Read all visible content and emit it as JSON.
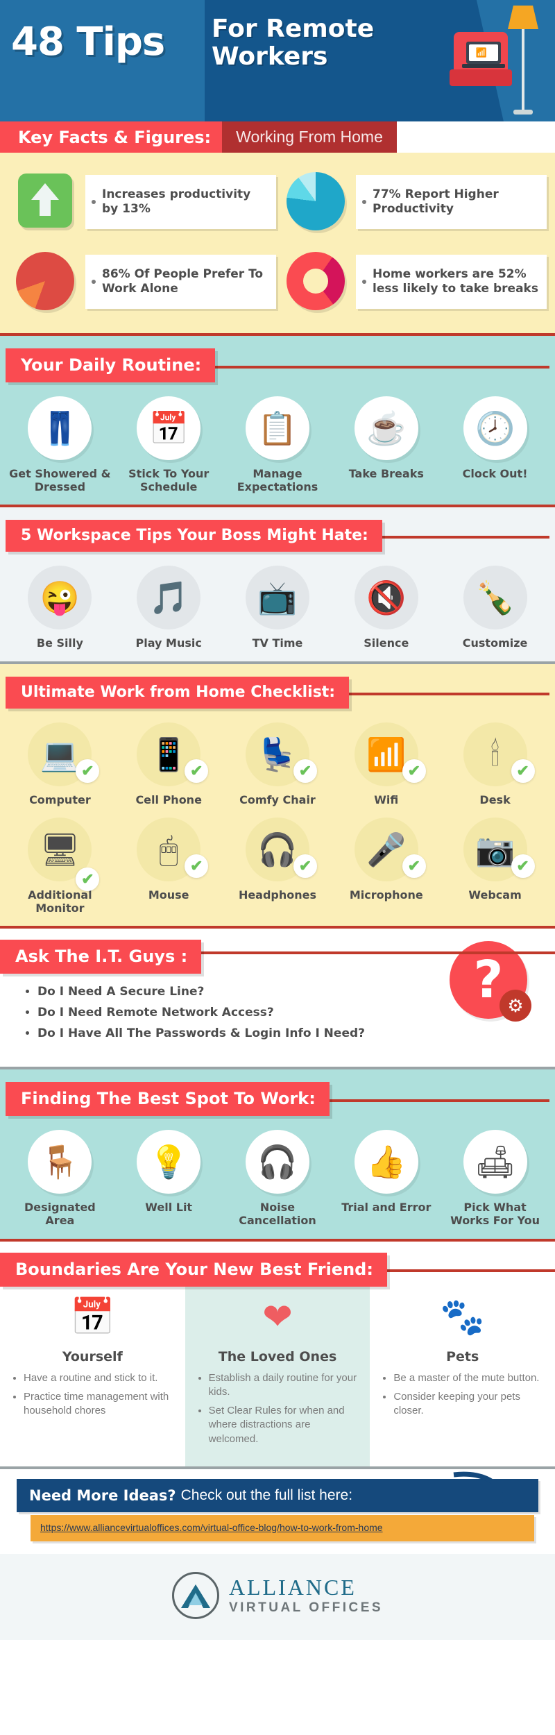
{
  "header": {
    "title_left": "48 Tips",
    "title_right": "For Remote Workers"
  },
  "key_facts": {
    "label": "Key Facts & Figures:",
    "sublabel": "Working From Home",
    "items": [
      {
        "icon": "up-arrow-icon",
        "text": "Increases productivity by 13%"
      },
      {
        "icon": "pie-chart-blue-icon",
        "text": "77% Report Higher Productivity"
      },
      {
        "icon": "pie-chart-red-icon",
        "text": "86% Of People Prefer To Work Alone"
      },
      {
        "icon": "donut-chart-icon",
        "text": "Home workers are 52% less likely to take breaks"
      }
    ]
  },
  "daily_routine": {
    "heading": "Your Daily Routine:",
    "items": [
      {
        "icon": "jeans-icon",
        "glyph": "👖",
        "label": "Get Showered & Dressed"
      },
      {
        "icon": "calendar-icon",
        "glyph": "📅",
        "label": "Stick To Your Schedule"
      },
      {
        "icon": "checklist-icon",
        "glyph": "📋",
        "label": "Manage Expectations"
      },
      {
        "icon": "coffee-dog-icon",
        "glyph": "☕",
        "label": "Take Breaks"
      },
      {
        "icon": "clock-icon",
        "glyph": "🕗",
        "label": "Clock Out!"
      }
    ]
  },
  "workspace_tips": {
    "heading": "5 Workspace Tips Your Boss Might Hate:",
    "items": [
      {
        "icon": "winking-face-icon",
        "glyph": "😜",
        "label": "Be Silly"
      },
      {
        "icon": "music-note-icon",
        "glyph": "🎵",
        "label": "Play Music"
      },
      {
        "icon": "television-icon",
        "glyph": "📺",
        "label": "TV Time"
      },
      {
        "icon": "mute-silence-icon",
        "glyph": "🔇",
        "label": "Silence"
      },
      {
        "icon": "message-bottle-icon",
        "glyph": "🍾",
        "label": "Customize"
      }
    ]
  },
  "checklist": {
    "heading": "Ultimate Work from Home Checklist:",
    "check_glyph": "✔",
    "items": [
      {
        "icon": "laptop-icon",
        "glyph": "💻",
        "label": "Computer"
      },
      {
        "icon": "cellphone-icon",
        "glyph": "📱",
        "label": "Cell Phone"
      },
      {
        "icon": "armchair-icon",
        "glyph": "💺",
        "label": "Comfy Chair"
      },
      {
        "icon": "wifi-icon",
        "glyph": "📶",
        "label": "Wifi"
      },
      {
        "icon": "desk-lamp-icon",
        "glyph": "🕯",
        "label": "Desk"
      },
      {
        "icon": "monitor-icon",
        "glyph": "🖥",
        "label": "Additional Monitor"
      },
      {
        "icon": "mouse-icon",
        "glyph": "🖱",
        "label": "Mouse"
      },
      {
        "icon": "headphones-icon",
        "glyph": "🎧",
        "label": "Headphones"
      },
      {
        "icon": "microphone-icon",
        "glyph": "🎤",
        "label": "Microphone"
      },
      {
        "icon": "webcam-icon",
        "glyph": "📷",
        "label": "Webcam"
      }
    ]
  },
  "it_guys": {
    "heading": "Ask The I.T. Guys :",
    "question_glyph": "?",
    "gear_glyph": "⚙",
    "questions": [
      "Do I Need A Secure Line?",
      "Do I Need Remote Network Access?",
      "Do I Have All The Passwords & Login Info I Need?"
    ]
  },
  "best_spot": {
    "heading": "Finding The Best Spot To Work:",
    "items": [
      {
        "icon": "desk-chair-icon",
        "glyph": "🪑",
        "label": "Designated Area"
      },
      {
        "icon": "lightbulb-icon",
        "glyph": "💡",
        "label": "Well Lit"
      },
      {
        "icon": "headphones-icon",
        "glyph": "🎧",
        "label": "Noise Cancellation"
      },
      {
        "icon": "thumbs-up-icon",
        "glyph": "👍",
        "label": "Trial and Error"
      },
      {
        "icon": "sofa-icon",
        "glyph": "🛋",
        "label": "Pick What Works For You"
      }
    ]
  },
  "boundaries": {
    "heading": "Boundaries Are Your New Best Friend:",
    "columns": [
      {
        "icon": "calendar-icon",
        "glyph": "📅",
        "title": "Yourself",
        "bullets": [
          "Have a routine and stick to it.",
          "Practice time management with household chores"
        ]
      },
      {
        "icon": "heart-icon",
        "glyph": "❤",
        "title": "The Loved Ones",
        "bullets": [
          "Establish a daily routine for your kids.",
          "Set Clear Rules for when and where distractions are welcomed."
        ]
      },
      {
        "icon": "paw-print-icon",
        "glyph": "🐾",
        "title": "Pets",
        "bullets": [
          "Be a master of the mute button.",
          "Consider keeping your pets closer."
        ]
      }
    ]
  },
  "footer": {
    "cta_bold": "Need More Ideas?",
    "cta_light": "Check out the full list here:",
    "url": "https://www.alliancevirtualoffices.com/virtual-office-blog/how-to-work-from-home",
    "logo_main": "ALLIANCE",
    "logo_sub": "VIRTUAL OFFICES"
  },
  "colors": {
    "accent_red": "#fa4b51",
    "header_blue": "#2471a6",
    "teal": "#aee0dc",
    "cream": "#fbefb9",
    "orange": "#f4a939",
    "green": "#6ac259"
  }
}
